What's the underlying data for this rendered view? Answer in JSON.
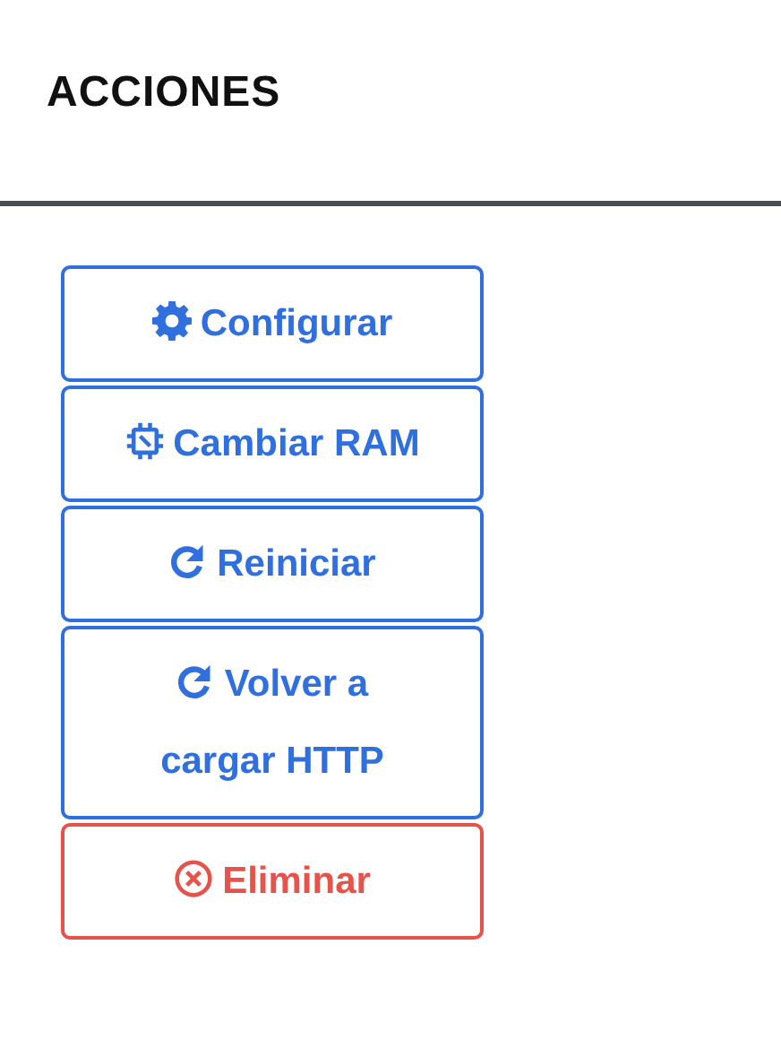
{
  "header": {
    "title": "ACCIONES"
  },
  "actions": [
    {
      "label": "Configurar",
      "kind": "gear"
    },
    {
      "label": "Cambiar RAM",
      "kind": "chip"
    },
    {
      "label": "Reiniciar",
      "kind": "reload"
    },
    {
      "label": "Volver a cargar HTTP",
      "kind": "reload"
    },
    {
      "label": "Eliminar",
      "kind": "delete"
    }
  ]
}
